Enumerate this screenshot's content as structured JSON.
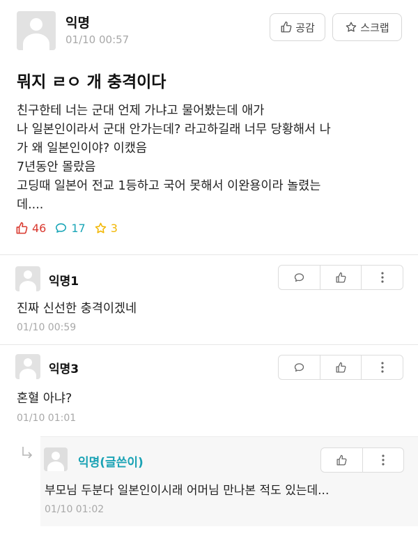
{
  "post": {
    "author": "익명",
    "timestamp": "01/10 00:57",
    "like_button_label": "공감",
    "scrap_button_label": "스크랩",
    "title": "뭐지 ㄹㅇ 개 충격이다",
    "body_lines": [
      "친구한테 너는 군대 언제 가냐고 물어봤는데 애가",
      "나 일본인이라서 군대 안가는데? 라고하길래 너무 당황해서 나",
      "가 왜 일본인이야? 이캤음",
      "7년동안 몰랐음",
      "고딩때 일본어 전교 1등하고 국어 못해서 이완용이라 놀렸는",
      "데...."
    ],
    "stats": {
      "likes": "46",
      "comments": "17",
      "scraps": "3"
    }
  },
  "comments": [
    {
      "author": "익명1",
      "text": "진짜 신선한 충격이겠네",
      "timestamp": "01/10 00:59"
    },
    {
      "author": "익명3",
      "text": "혼혈 아냐?",
      "timestamp": "01/10 01:01"
    }
  ],
  "reply": {
    "author": "익명(글쓴이)",
    "text": "부모님 두분다 일본인이시래 어머님 만나본 적도 있는데...",
    "timestamp": "01/10 01:02"
  },
  "colors": {
    "like": "#d9382e",
    "comment": "#1aa6b7",
    "scrap": "#f2b705",
    "op_name": "#19a2b4"
  }
}
